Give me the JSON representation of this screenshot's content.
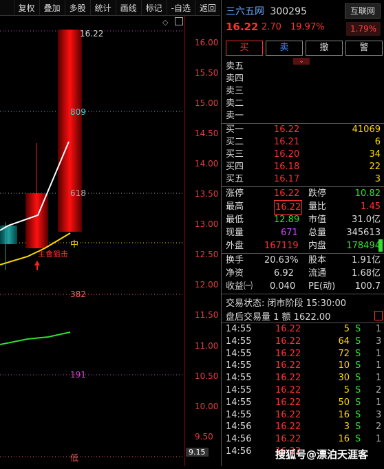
{
  "toolbar": {
    "items": [
      "复权",
      "叠加",
      "多股",
      "统计",
      "画线",
      "标记",
      "-自选",
      "返回"
    ]
  },
  "chart": {
    "axis_labels": [
      "16.00",
      "15.50",
      "15.00",
      "14.50",
      "14.00",
      "13.50",
      "13.00",
      "12.50",
      "12.00",
      "11.50",
      "11.00",
      "10.50",
      "10.00",
      "9.50"
    ],
    "top_value": "16.22",
    "low_value": "9.15",
    "fib_809": "809",
    "fib_618": "618",
    "fib_382": "382",
    "fib_191": "191",
    "mid_label": "中",
    "low_label": "低",
    "annotation": "主會狙击"
  },
  "quote": {
    "name": "三六五网",
    "code": "300295",
    "tag": "互联网",
    "tag_pct": "1.79%",
    "price": "16.22",
    "change": "2.70",
    "change_pct": "19.97%"
  },
  "buttons": {
    "buy": "买",
    "sell": "卖",
    "cancel": "撤",
    "alert": "警"
  },
  "asks": [
    {
      "label": "卖五"
    },
    {
      "label": "卖四"
    },
    {
      "label": "卖三"
    },
    {
      "label": "卖二"
    },
    {
      "label": "卖一"
    }
  ],
  "bids": [
    {
      "label": "买一",
      "price": "16.22",
      "vol": "41069"
    },
    {
      "label": "买二",
      "price": "16.21",
      "vol": "6"
    },
    {
      "label": "买三",
      "price": "16.20",
      "vol": "34"
    },
    {
      "label": "买四",
      "price": "16.18",
      "vol": "22"
    },
    {
      "label": "买五",
      "price": "16.17",
      "vol": "3"
    }
  ],
  "stats": [
    {
      "l1": "涨停",
      "v1": "16.22",
      "l2": "跌停",
      "v2": "10.82"
    },
    {
      "l1": "最高",
      "v1": "16.22",
      "l2": "量比",
      "v2": "1.45"
    },
    {
      "l1": "最低",
      "v1": "12.89",
      "l2": "市值",
      "v2": "31.0亿"
    },
    {
      "l1": "现量",
      "v1": "671",
      "l2": "总量",
      "v2": "345613"
    },
    {
      "l1": "外盘",
      "v1": "167119",
      "l2": "内盘",
      "v2": "178494"
    }
  ],
  "stats2": [
    {
      "l1": "换手",
      "v1": "20.63%",
      "l2": "股本",
      "v2": "1.91亿"
    },
    {
      "l1": "净资",
      "v1": "6.92",
      "l2": "流通",
      "v2": "1.68亿"
    },
    {
      "l1": "收益㈠",
      "v1": "0.040",
      "l2": "PE(动)",
      "v2": "100.7"
    }
  ],
  "status": {
    "line1": "交易状态: 闭市阶段 15:30:00",
    "line2": "盘后交易量 1 额 1622.00"
  },
  "ticks": [
    {
      "t": "14:55",
      "p": "16.22",
      "v": "5",
      "s": "S",
      "n": "1"
    },
    {
      "t": "14:55",
      "p": "16.22",
      "v": "64",
      "s": "S",
      "n": "3"
    },
    {
      "t": "14:55",
      "p": "16.22",
      "v": "72",
      "s": "S",
      "n": "1"
    },
    {
      "t": "14:55",
      "p": "16.22",
      "v": "10",
      "s": "S",
      "n": "1"
    },
    {
      "t": "14:55",
      "p": "16.22",
      "v": "30",
      "s": "S",
      "n": "1"
    },
    {
      "t": "14:55",
      "p": "16.22",
      "v": "5",
      "s": "S",
      "n": "2"
    },
    {
      "t": "14:55",
      "p": "16.22",
      "v": "50",
      "s": "S",
      "n": "1"
    },
    {
      "t": "14:55",
      "p": "16.22",
      "v": "16",
      "s": "S",
      "n": "3"
    },
    {
      "t": "14:56",
      "p": "16.22",
      "v": "3",
      "s": "S",
      "n": "2"
    },
    {
      "t": "14:56",
      "p": "16.22",
      "v": "16",
      "s": "S",
      "n": "1"
    },
    {
      "t": "14:56",
      "p": "16.22",
      "v": "",
      "s": "",
      "n": ""
    }
  ],
  "watermark": "搜狐号@漂泊天涯客"
}
